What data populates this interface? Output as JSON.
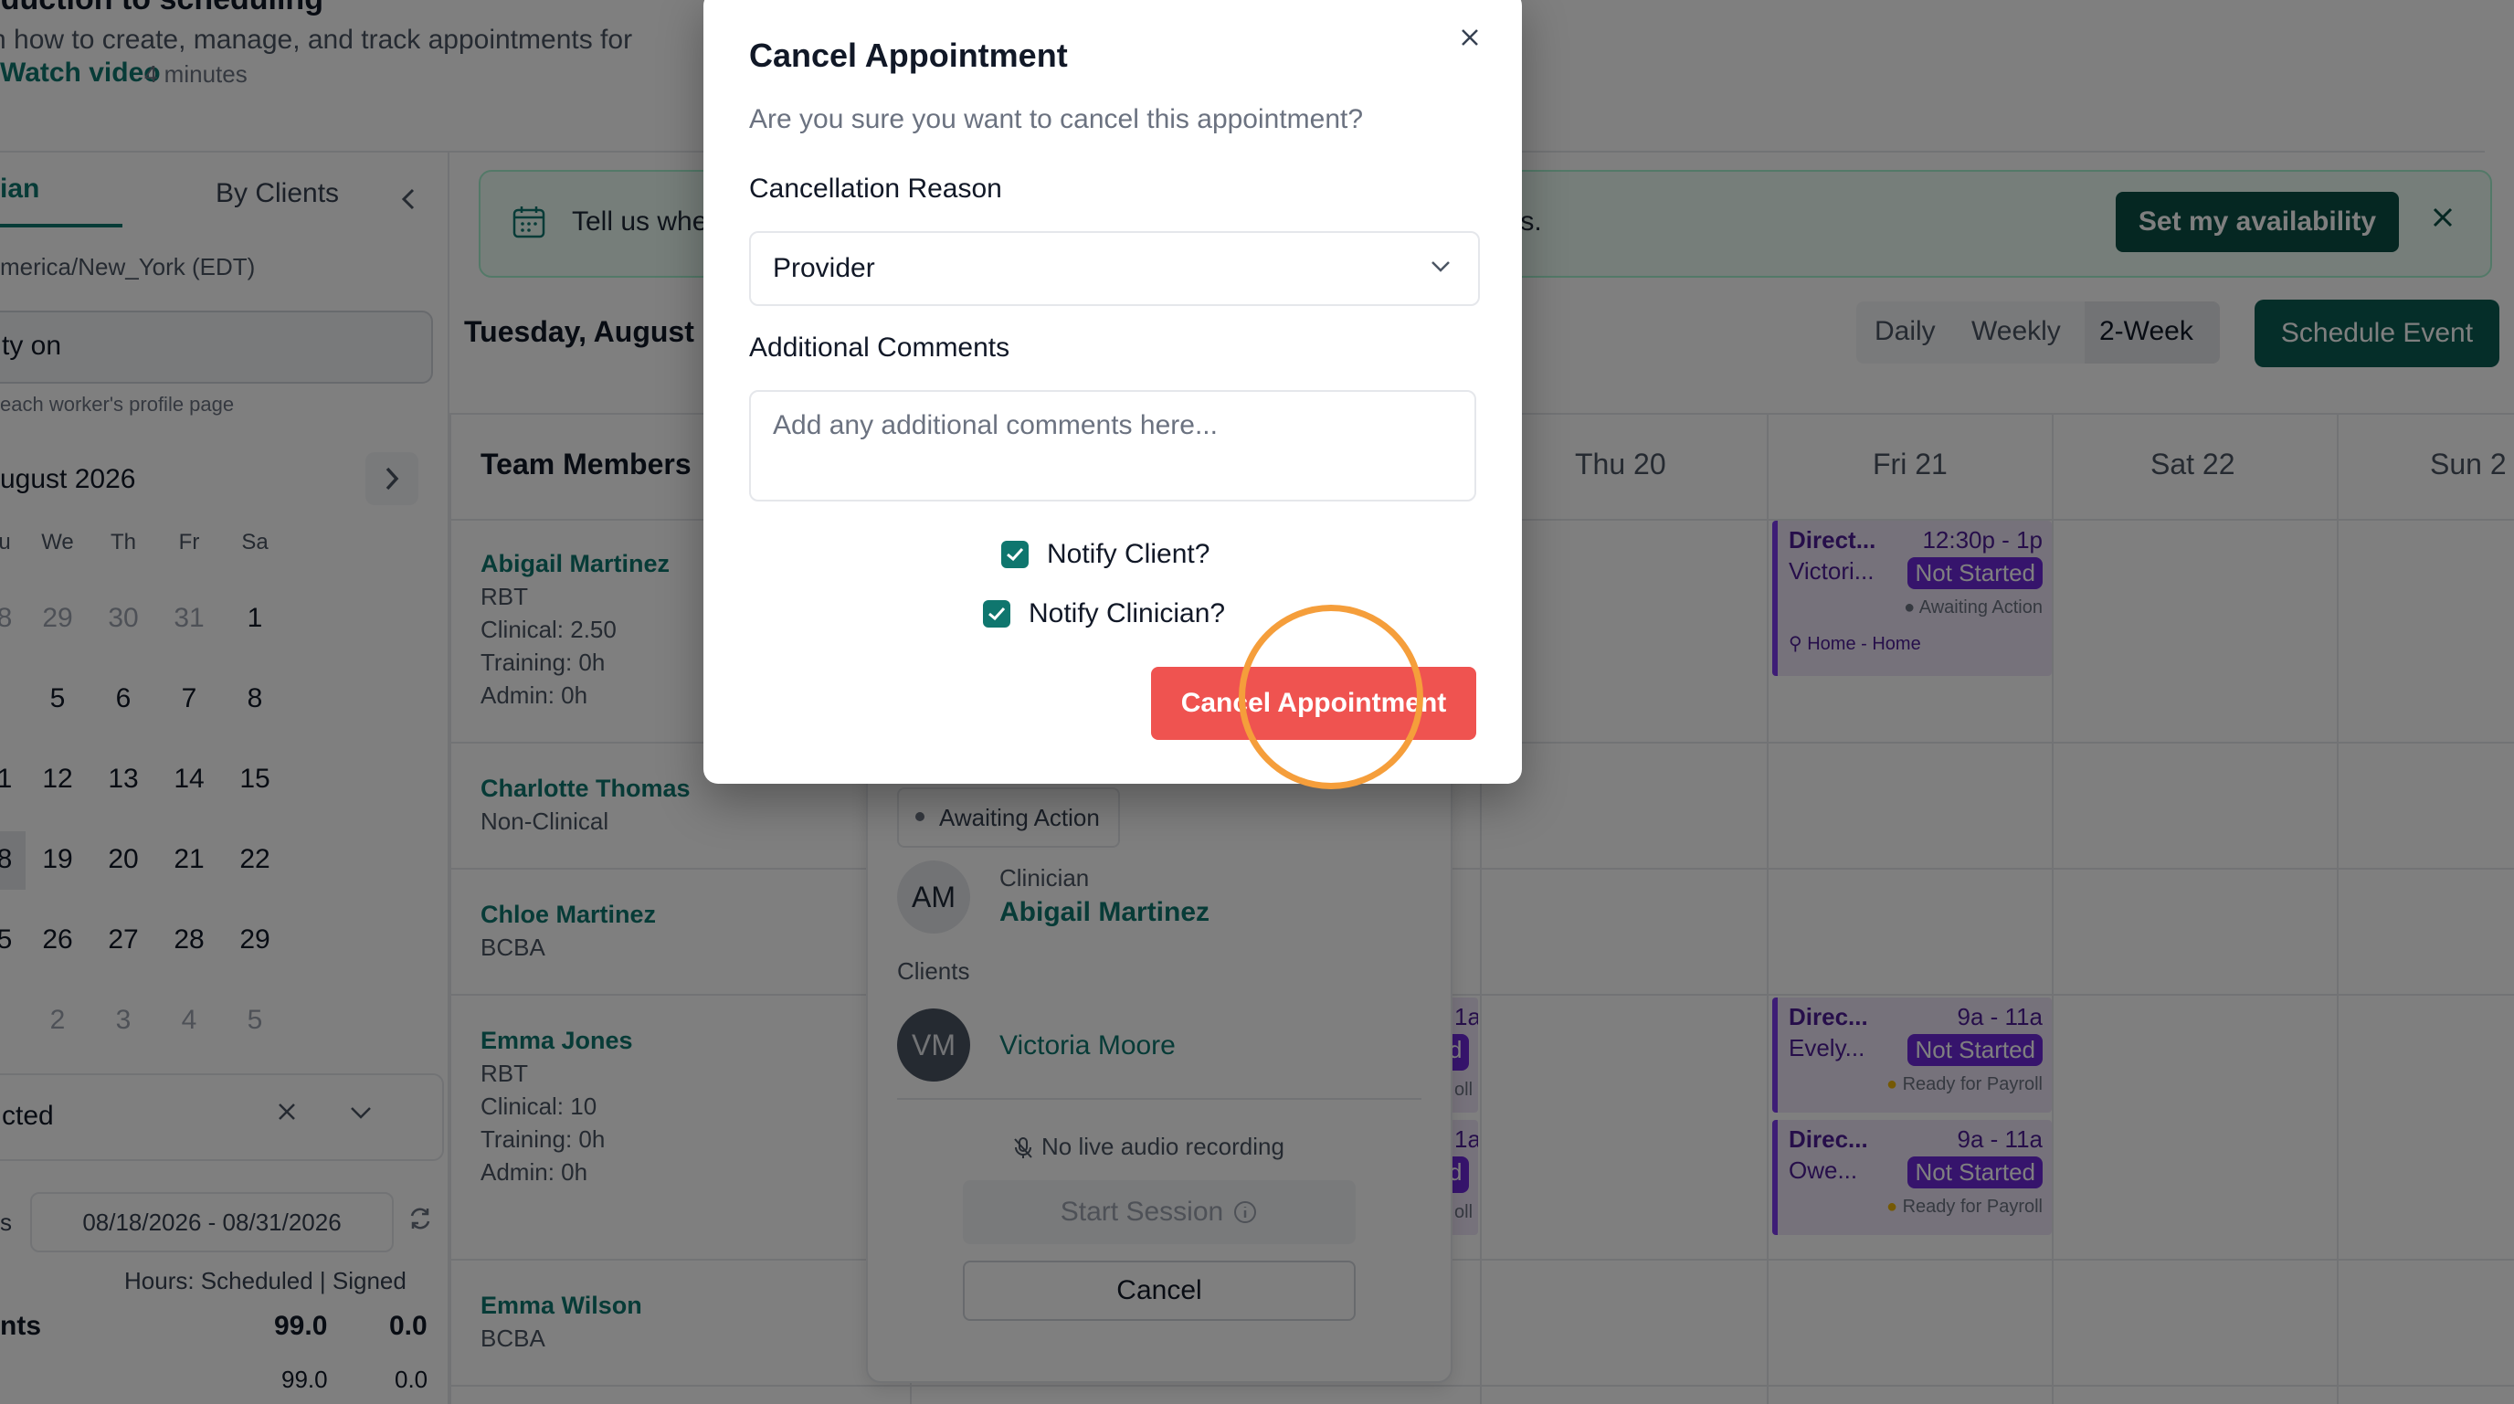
{
  "intro": {
    "title": "oduction to scheduling",
    "description": "rn how to create, manage, and track appointments for",
    "watch_label": "Watch video",
    "duration": "4 minutes"
  },
  "sidebar": {
    "tab_active": "ian",
    "tab_clients": "By Clients",
    "timezone": "merica/New_York (EDT)",
    "availability_label": "ty on",
    "availability_hint": "each worker's profile page",
    "month_label": "ugust 2026",
    "calendar": {
      "dow": [
        "u",
        "We",
        "Th",
        "Fr",
        "Sa"
      ],
      "weeks": [
        [
          "8",
          "29",
          "30",
          "31",
          "1"
        ],
        [
          "",
          "5",
          "6",
          "7",
          "8"
        ],
        [
          "1",
          "12",
          "13",
          "14",
          "15"
        ],
        [
          "8",
          "19",
          "20",
          "21",
          "22"
        ],
        [
          "5",
          "26",
          "27",
          "28",
          "29"
        ],
        [
          "",
          "2",
          "3",
          "4",
          "5"
        ]
      ]
    },
    "filter_label": "cted",
    "date_range_prefix": "s",
    "date_range": "08/18/2026 - 08/31/2026",
    "hours_header": "Hours:  Scheduled | Signed",
    "hours_rows": [
      {
        "label": "nts",
        "scheduled": "99.0",
        "signed": "0.0"
      },
      {
        "label": "",
        "scheduled": "99.0",
        "signed": "0.0"
      }
    ]
  },
  "info_banner": {
    "text_start": "Tell us whe",
    "text_end": "ts.",
    "button": "Set my availability"
  },
  "toolbar": {
    "day_title": "Tuesday, August",
    "views": [
      "Daily",
      "Weekly",
      "2-Week"
    ],
    "active_view": "2-Week",
    "schedule_button": "Schedule Event"
  },
  "grid": {
    "team_members_header": "Team Members",
    "days": [
      "Thu 20",
      "Fri 21",
      "Sat 22",
      "Sun 2"
    ],
    "members": [
      {
        "name": "Abigail Martinez",
        "lines": [
          "RBT",
          "Clinical: 2.50",
          "Training: 0h",
          "Admin: 0h"
        ]
      },
      {
        "name": "Charlotte Thomas",
        "lines": [
          "Non-Clinical"
        ]
      },
      {
        "name": "Chloe Martinez",
        "lines": [
          "BCBA"
        ]
      },
      {
        "name": "Emma Jones",
        "lines": [
          "RBT",
          "Clinical: 10",
          "Training: 0h",
          "Admin: 0h"
        ]
      },
      {
        "name": "Emma Wilson",
        "lines": [
          "BCBA"
        ]
      }
    ],
    "events": [
      {
        "title": "Direct...",
        "time": "12:30p - 1p",
        "client": "Victori...",
        "badge": "Not Started",
        "status": "Awaiting Action",
        "location": "Home - Home"
      },
      {
        "title": "Direc...",
        "time": "9a - 11a",
        "client": "Evely...",
        "badge": "Not Started",
        "status": "Ready for Payroll"
      },
      {
        "title": "Direc...",
        "time": "9a - 11a",
        "client": "Owe...",
        "badge": "Not Started",
        "status": "Ready for Payroll"
      }
    ],
    "partial_events": [
      {
        "time": "1a",
        "badge": "d",
        "status": "oll"
      },
      {
        "time": "1a",
        "badge": "d",
        "status": "oll"
      }
    ]
  },
  "popover": {
    "status": "Awaiting Action",
    "clinician_label": "Clinician",
    "clinician_initials": "AM",
    "clinician_name": "Abigail Martinez",
    "clients_label": "Clients",
    "client_initials": "VM",
    "client_name": "Victoria Moore",
    "no_recording": "No live audio recording",
    "start_session": "Start Session",
    "cancel": "Cancel"
  },
  "modal": {
    "title": "Cancel Appointment",
    "subtitle": "Are you sure you want to cancel this appointment?",
    "reason_label": "Cancellation Reason",
    "reason_value": "Provider",
    "comments_label": "Additional Comments",
    "comments_placeholder": "Add any additional comments here...",
    "notify_client_label": "Notify Client?",
    "notify_client_checked": true,
    "notify_clinician_label": "Notify Clinician?",
    "notify_clinician_checked": true,
    "confirm_button": "Cancel Appointment"
  },
  "colors": {
    "brand": "#0f766e",
    "danger": "#ef5350",
    "event_purple": "#6d28d9",
    "highlight": "#f59e3b"
  }
}
